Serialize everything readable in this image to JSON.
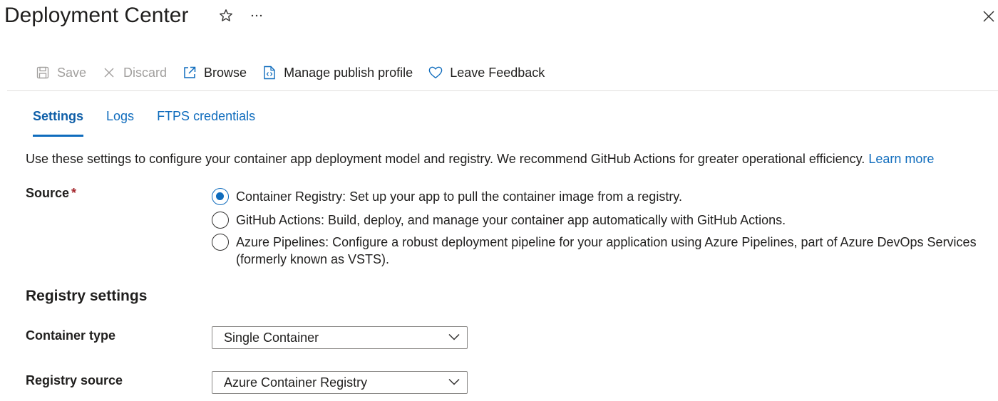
{
  "header": {
    "title": "Deployment Center",
    "favorite_icon": "star-outline-icon",
    "more_icon": "ellipsis-icon",
    "close_icon": "close-icon"
  },
  "toolbar": {
    "save_label": "Save",
    "discard_label": "Discard",
    "browse_label": "Browse",
    "manage_publish_profile_label": "Manage publish profile",
    "leave_feedback_label": "Leave Feedback"
  },
  "tabs": [
    {
      "label": "Settings",
      "active": true
    },
    {
      "label": "Logs",
      "active": false
    },
    {
      "label": "FTPS credentials",
      "active": false
    }
  ],
  "description": {
    "text": "Use these settings to configure your container app deployment model and registry. We recommend GitHub Actions for greater operational efficiency.",
    "link": "Learn more"
  },
  "source": {
    "label": "Source",
    "required_mark": "*",
    "options": [
      {
        "label": "Container Registry: Set up your app to pull the container image from a registry.",
        "checked": true
      },
      {
        "label": "GitHub Actions: Build, deploy, and manage your container app automatically with GitHub Actions.",
        "checked": false
      },
      {
        "label": "Azure Pipelines: Configure a robust deployment pipeline for your application using Azure Pipelines, part of Azure DevOps Services (formerly known as VSTS).",
        "checked": false
      }
    ]
  },
  "registry_settings": {
    "title": "Registry settings",
    "container_type": {
      "label": "Container type",
      "value": "Single Container"
    },
    "registry_source": {
      "label": "Registry source",
      "value": "Azure Container Registry"
    }
  },
  "colors": {
    "accent": "#0f6cbd",
    "required": "#a4262c",
    "disabled_text": "#a19f9d"
  }
}
